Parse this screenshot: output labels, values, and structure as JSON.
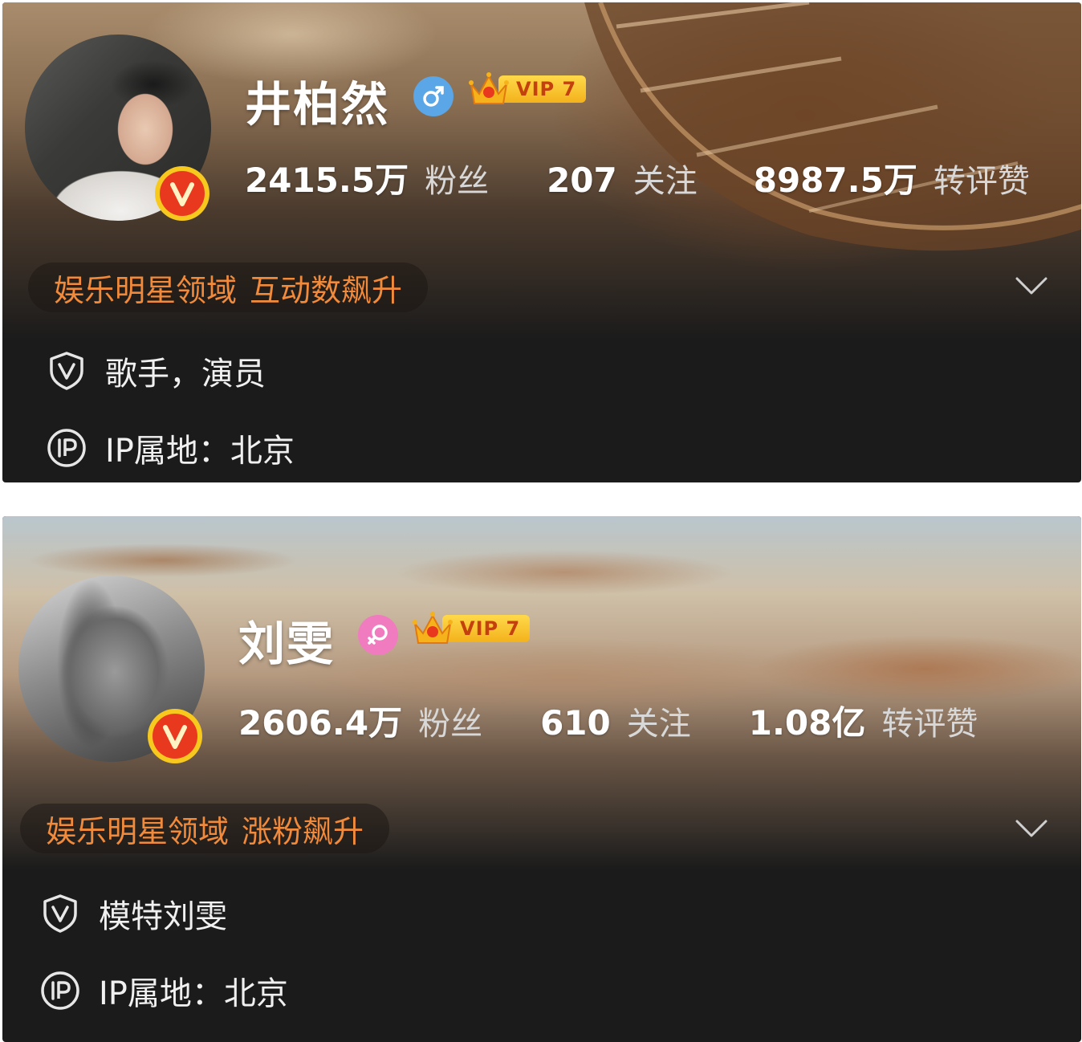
{
  "profiles": [
    {
      "name": "井柏然",
      "gender_icon": "male-icon",
      "vip_label": "VIP 7",
      "stats": [
        {
          "num": "2415.5万",
          "label": "粉丝"
        },
        {
          "num": "207",
          "label": "关注"
        },
        {
          "num": "8987.5万",
          "label": "转评赞"
        }
      ],
      "honor": {
        "domain": "娱乐明星领域",
        "trend": "互动数飙升"
      },
      "description": "歌手，演员",
      "ip_location": "IP属地：北京"
    },
    {
      "name": "刘雯",
      "gender_icon": "female-icon",
      "vip_label": "VIP 7",
      "stats": [
        {
          "num": "2606.4万",
          "label": "粉丝"
        },
        {
          "num": "610",
          "label": "关注"
        },
        {
          "num": "1.08亿",
          "label": "转评赞"
        }
      ],
      "honor": {
        "domain": "娱乐明星领域",
        "trend": "涨粉飙升"
      },
      "description": "模特刘雯",
      "ip_location": "IP属地：北京"
    }
  ],
  "colors": {
    "honor_text": "#f18a3a",
    "vbadge_red": "#e8391f",
    "vbadge_ring": "#f7c91e",
    "male": "#5ba6e6",
    "female": "#f07cbf",
    "card_bg": "#1b1b1b"
  }
}
